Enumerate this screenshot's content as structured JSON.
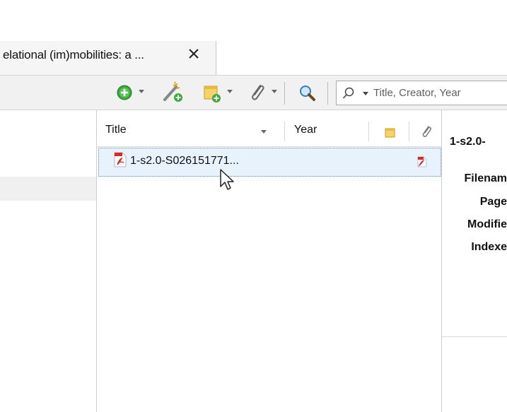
{
  "tab": {
    "title": "elational (im)mobilities: a ...",
    "close_glyph": "×"
  },
  "toolbar": {
    "icons": [
      "new-item-icon",
      "add-by-identifier-icon",
      "new-note-icon",
      "attachment-icon",
      "locate-icon"
    ],
    "search": {
      "placeholder": "Title, Creator, Year"
    }
  },
  "items": {
    "columns": {
      "title": "Title",
      "year": "Year"
    },
    "rows": [
      {
        "title": "1-s2.0-S026151771...",
        "type": "pdf-attachment"
      }
    ]
  },
  "item_pane": {
    "title": "1-s2.0-",
    "labels": {
      "filename": "Filenam",
      "pages": "Page",
      "modified": "Modifie",
      "indexed": "Indexe"
    }
  },
  "colors": {
    "selection": "#e8f2fc",
    "selection_border": "#5a8ac6",
    "pdf_red": "#d62a2a",
    "toolbar_bg": "#f1f1f1"
  }
}
